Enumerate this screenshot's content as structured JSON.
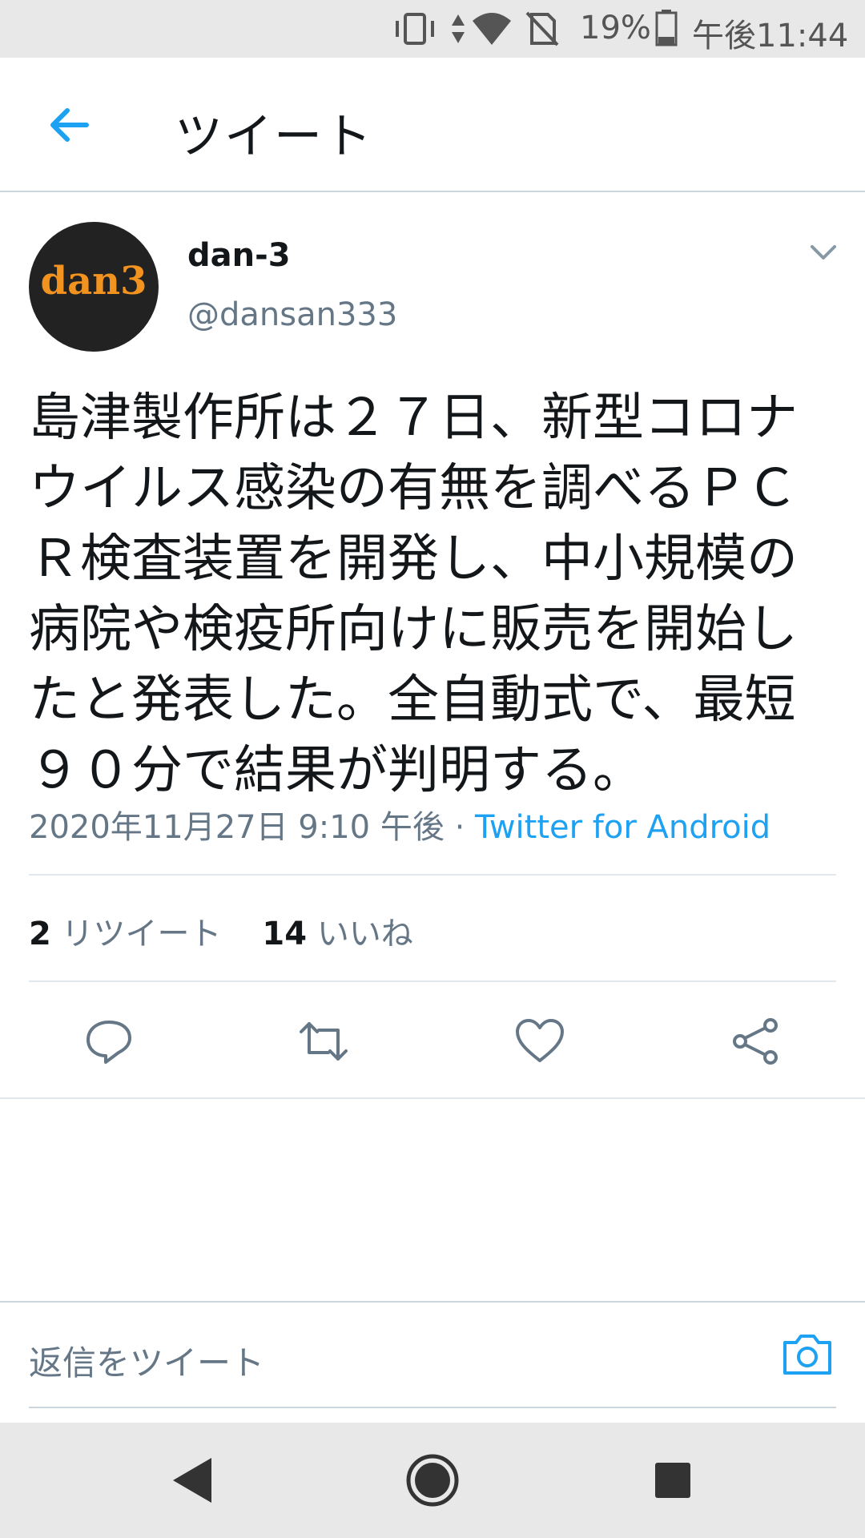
{
  "status_bar": {
    "battery_percent": "19%",
    "time": "午後11:44",
    "icons": [
      "vibrate-icon",
      "data-arrows-icon",
      "wifi-icon",
      "no-sim-icon",
      "battery-icon"
    ]
  },
  "header": {
    "title": "ツイート",
    "back_icon": "arrow-left-icon"
  },
  "tweet": {
    "avatar_text": "dan3",
    "display_name": "dan-3",
    "handle": "@dansan333",
    "text": "島津製作所は２７日、新型コロナウイルス感染の有無を調べるＰＣＲ検査装置を開発し、中小規模の病院や検疫所向けに販売を開始したと発表した。全自動式で、最短９０分で結果が判明する。",
    "timestamp": "2020年11月27日 9:10 午後",
    "separator": " · ",
    "source": "Twitter for Android"
  },
  "stats": {
    "retweets_count": "2",
    "retweets_label": "リツイート",
    "likes_count": "14",
    "likes_label": "いいね"
  },
  "actions": [
    "reply-icon",
    "retweet-icon",
    "like-icon",
    "share-icon"
  ],
  "reply_bar": {
    "placeholder": "返信をツイート",
    "camera_icon": "camera-icon"
  },
  "colors": {
    "accent": "#1da1f2",
    "secondary_text": "#657786",
    "primary_text": "#14171a",
    "avatar_bg": "#222222",
    "avatar_text": "#f29320"
  }
}
